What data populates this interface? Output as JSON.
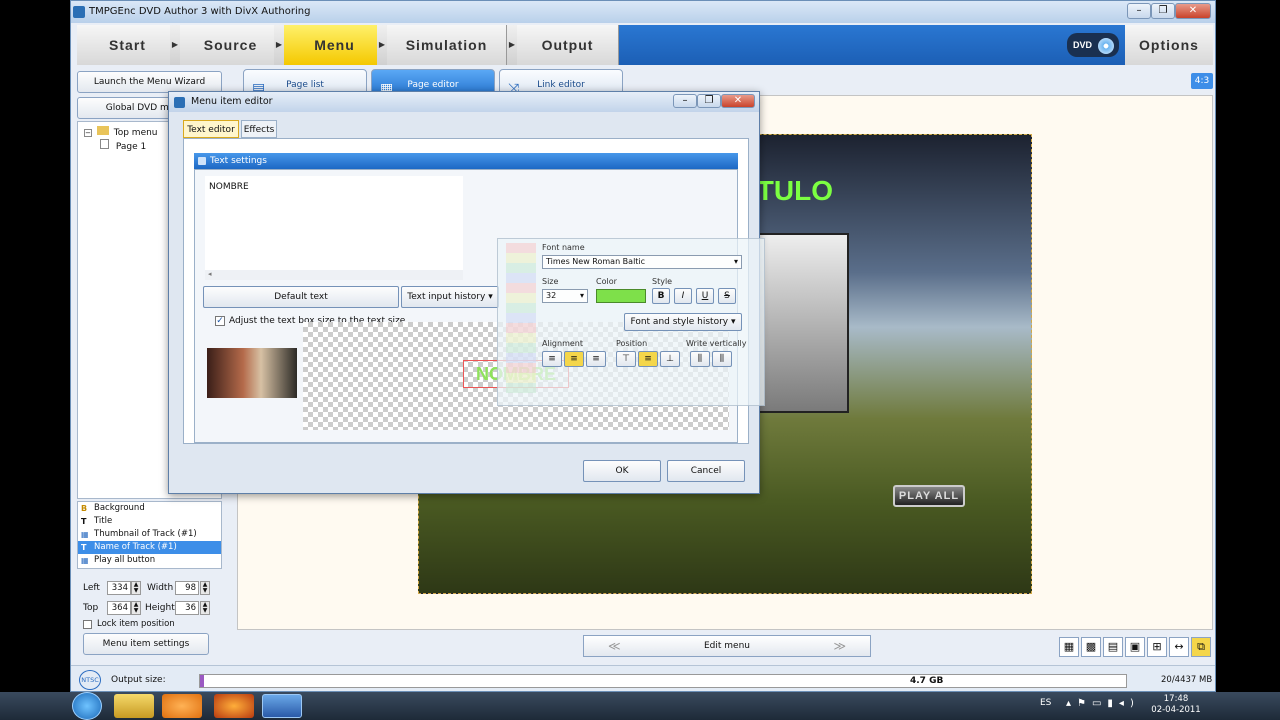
{
  "window": {
    "title": "TMPGEnc DVD Author 3 with DivX Authoring",
    "minimize_glyph": "–",
    "restore_glyph": "❐",
    "close_glyph": "✕"
  },
  "steps": [
    "Start",
    "Source",
    "Menu",
    "Simulation",
    "Output"
  ],
  "active_step": "Menu",
  "options_label": "Options",
  "dvd_logo": "DVD",
  "aspect_badge": "4:3",
  "left_panel": {
    "launch_wizard": "Launch the Menu Wizard",
    "global_menu": "Global DVD menu s",
    "tree_root": "Top menu",
    "tree_child": "Page 1",
    "layers": [
      {
        "icon": "B",
        "label": "Background"
      },
      {
        "icon": "T",
        "label": "Title"
      },
      {
        "icon": "▦",
        "label": "Thumbnail of Track (#1)"
      },
      {
        "icon": "T",
        "label": "Name of Track (#1)"
      },
      {
        "icon": "▦",
        "label": "Play all button"
      }
    ],
    "selected_layer_index": 3,
    "left_label": "Left",
    "left_value": "334",
    "width_label": "Width",
    "width_value": "98",
    "top_label": "Top",
    "top_value": "364",
    "height_label": "Height",
    "height_value": "36",
    "lock_label": "Lock item position",
    "settings_button": "Menu item settings"
  },
  "page_tabs": [
    "Page list",
    "Page editor",
    "Link editor"
  ],
  "active_page_tab": "Page editor",
  "canvas": {
    "title_text": "ITULO",
    "play_all": "PLAY ALL"
  },
  "edit_nav": {
    "prev": "≪",
    "label": "Edit menu",
    "next": "≫"
  },
  "view_icons": [
    "▦",
    "▩",
    "▤",
    "▣",
    "⊞",
    "↔",
    "⧉"
  ],
  "status": {
    "ntsc": "NTSC",
    "output_size_label": "Output size:",
    "capacity": "4.7 GB",
    "usage": "20/4437 MB"
  },
  "dialog": {
    "title": "Menu item editor",
    "tabs": [
      "Text editor",
      "Effects"
    ],
    "section_title": "Text settings",
    "text_value": "NOMBRE",
    "default_text_button": "Default text",
    "history_button": "Text input history",
    "adjust_checkbox_label": "Adjust the text box size to the text size",
    "font_name_label": "Font name",
    "font_name_value": "Times New Roman Baltic",
    "size_label": "Size",
    "size_value": "32",
    "color_label": "Color",
    "style_label": "Style",
    "font_history": "Font and style history",
    "alignment_label": "Alignment",
    "position_label": "Position",
    "write_vertically_label": "Write vertically",
    "preview_text": "NOMBRE",
    "ok_button": "OK",
    "cancel_button": "Cancel",
    "bold": "B",
    "italic": "I",
    "underline": "U",
    "strike": "S"
  },
  "taskbar": {
    "lang": "ES",
    "time": "17:48",
    "date": "02-04-2011"
  }
}
